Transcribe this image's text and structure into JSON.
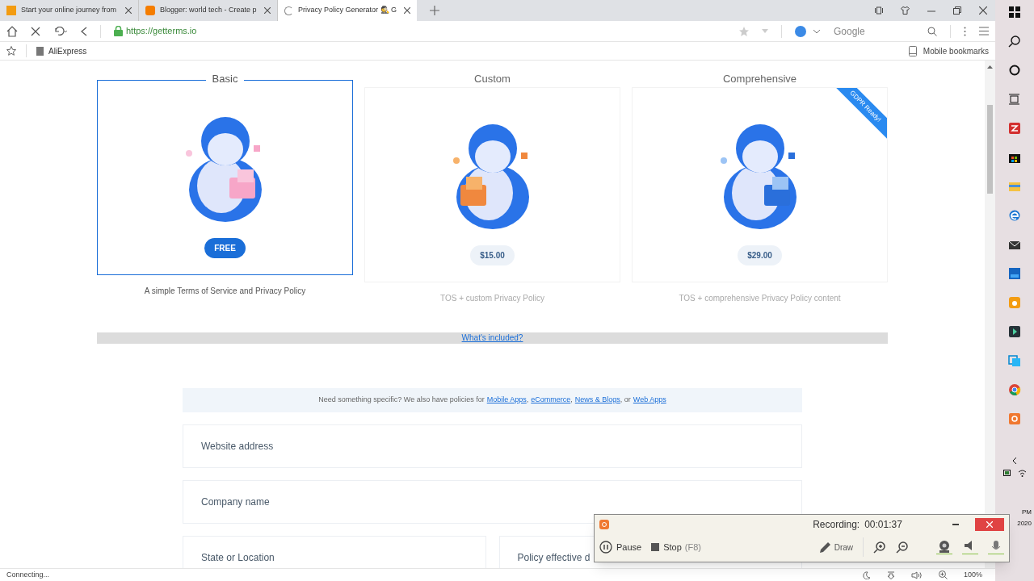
{
  "tabs": [
    {
      "label": "Start your online journey from",
      "selected": false,
      "kind": "site"
    },
    {
      "label": "Blogger: world tech - Create p",
      "selected": false,
      "kind": "blogger"
    },
    {
      "label": "Privacy Policy Generator 🕵 G",
      "selected": true,
      "kind": "loading"
    }
  ],
  "address": {
    "url": "https://getterms.io",
    "search_engine": "Google"
  },
  "bookmarks": [
    "AliExpress"
  ],
  "mobile_bookmarks": "Mobile bookmarks",
  "plans": [
    {
      "name": "Basic",
      "price": "FREE",
      "description": "A simple Terms of Service and Privacy Policy",
      "selected": true
    },
    {
      "name": "Custom",
      "price": "$15.00",
      "description": "TOS + custom Privacy Policy",
      "selected": false
    },
    {
      "name": "Comprehensive",
      "price": "$29.00",
      "description": "TOS + comprehensive Privacy Policy content",
      "selected": false,
      "ribbon": "GDPR Ready!"
    }
  ],
  "whats_included": "What's included?",
  "notice": {
    "text": "Need something specific? We also have policies for",
    "links": [
      "Mobile Apps",
      "eCommerce",
      "News & Blogs",
      "Web Apps"
    ],
    "separators": [
      ",",
      ",",
      ", or"
    ]
  },
  "fields": [
    {
      "placeholder": "Website address",
      "kind": "full"
    },
    {
      "placeholder": "Company name",
      "kind": "full"
    },
    {
      "placeholder": "State or Location",
      "kind": "half"
    },
    {
      "placeholder": "Policy effective d",
      "kind": "half"
    }
  ],
  "status_bar": {
    "text": "Connecting...",
    "zoom": "100%"
  },
  "recorder": {
    "label": "Recording:",
    "time": "00:01:37",
    "pause": "Pause",
    "stop": "Stop",
    "stop_key": "(F8)",
    "draw": "Draw"
  },
  "tray": {
    "time": "PM",
    "date": "2020"
  }
}
